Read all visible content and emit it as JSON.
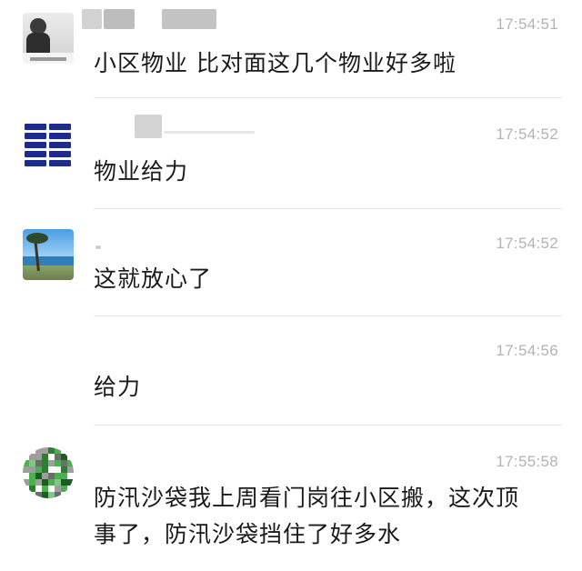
{
  "messages": [
    {
      "avatar": "portrait-photo-avatar",
      "time": "17:54:51",
      "lines": [
        "小区物业 比对面这几个物业好多啦"
      ]
    },
    {
      "avatar": "text-grid-avatar",
      "time": "17:54:52",
      "lines": [
        "物业给力"
      ]
    },
    {
      "avatar": "beach-palm-avatar",
      "time": "17:54:52",
      "lines": [
        "这就放心了"
      ]
    },
    {
      "avatar": "none",
      "time": "17:54:56",
      "lines": [
        "给力"
      ]
    },
    {
      "avatar": "mosaic-qr-avatar",
      "time": "17:55:58",
      "lines": [
        "防汛沙袋我上周看门岗往小区搬，这次顶",
        "事了，防汛沙袋挡住了好多水"
      ]
    }
  ],
  "colors": {
    "time": "#b3b3b3",
    "text": "#1a1a1a",
    "divider": "#e6e6e6",
    "background": "#ffffff"
  }
}
